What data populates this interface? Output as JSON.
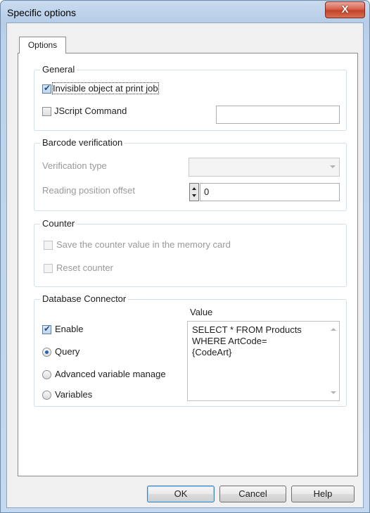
{
  "window": {
    "title": "Specific options",
    "close_label": "X"
  },
  "tabs": [
    {
      "label": "Options"
    }
  ],
  "general": {
    "title": "General",
    "invisible_label": "Invisible object at print job",
    "invisible_checked": true,
    "jscript_label": "JScript Command",
    "jscript_checked": false,
    "jscript_value": ""
  },
  "barcode": {
    "title": "Barcode verification",
    "type_label": "Verification type",
    "type_value": "",
    "offset_label": "Reading position offset",
    "offset_value": "0"
  },
  "counter": {
    "title": "Counter",
    "save_label": "Save the counter value in the memory card",
    "reset_label": "Reset counter"
  },
  "database": {
    "title": "Database Connector",
    "value_header": "Value",
    "enable_label": "Enable",
    "enable_checked": true,
    "options": [
      {
        "label": "Query",
        "selected": true
      },
      {
        "label": "Advanced variable manage",
        "selected": false
      },
      {
        "label": "Variables",
        "selected": false
      }
    ],
    "value_text": "SELECT * FROM Products\nWHERE ArtCode=\n{CodeArt}"
  },
  "buttons": {
    "ok": "OK",
    "cancel": "Cancel",
    "help": "Help"
  }
}
